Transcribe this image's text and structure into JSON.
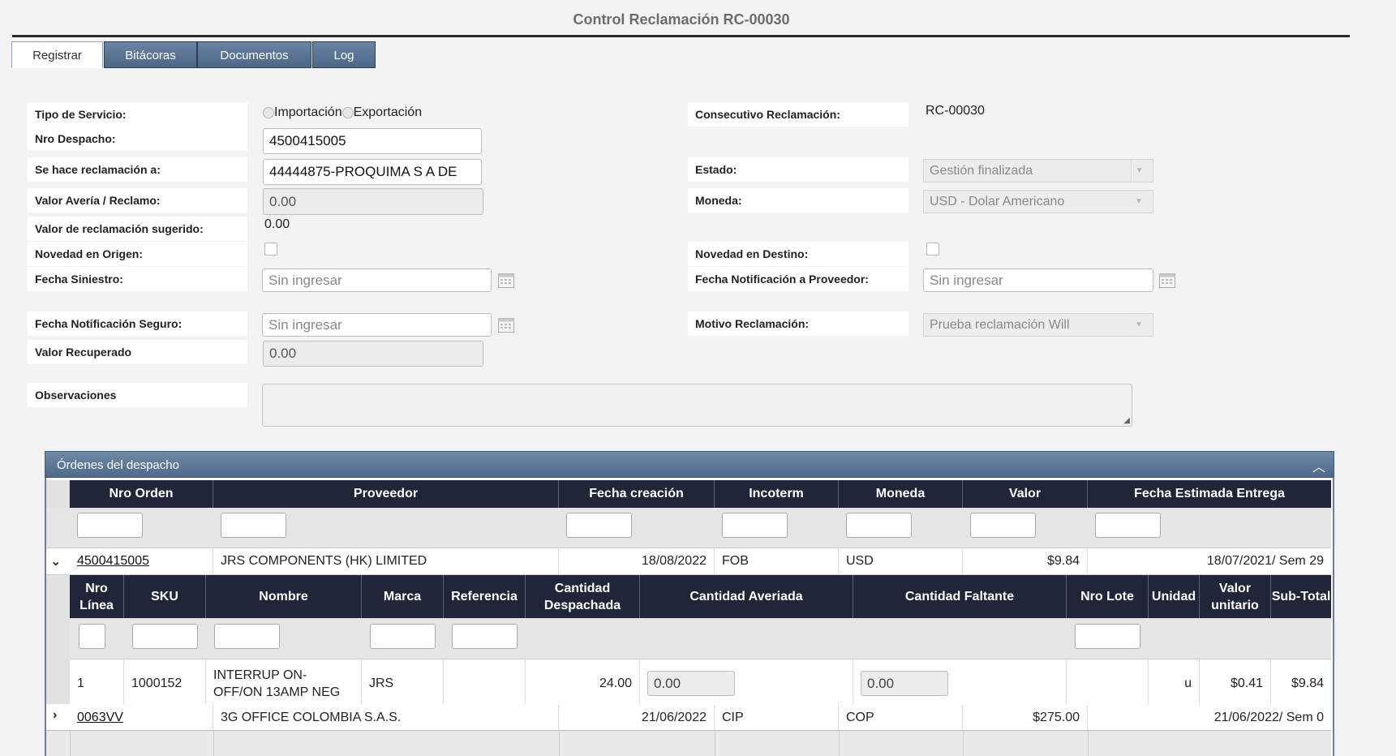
{
  "page_title": "Control Reclamación RC-00030",
  "tabs": [
    {
      "label": "Registrar"
    },
    {
      "label": "Bitácoras"
    },
    {
      "label": "Documentos"
    },
    {
      "label": "Log"
    }
  ],
  "form": {
    "tipo_servicio": {
      "label": "Tipo de Servicio:",
      "options": [
        "Importación",
        "Exportación"
      ]
    },
    "nro_despacho": {
      "label": "Nro Despacho:",
      "value": "4500415005"
    },
    "reclamacion_a": {
      "label": "Se hace reclamación a:",
      "value": "44444875-PROQUIMA S A DE"
    },
    "valor_averia": {
      "label": "Valor Avería / Reclamo:",
      "value": "0.00"
    },
    "valor_sugerido": {
      "label": "Valor de reclamación sugerido:",
      "value": "0.00"
    },
    "novedad_origen": {
      "label": "Novedad en Origen:"
    },
    "fecha_siniestro": {
      "label": "Fecha Siniestro:",
      "placeholder": "Sin ingresar"
    },
    "fecha_notif_seguro": {
      "label": "Fecha Notificación Seguro:",
      "placeholder": "Sin ingresar"
    },
    "valor_recuperado": {
      "label": "Valor Recuperado",
      "value": "0.00"
    },
    "observaciones": {
      "label": "Observaciones",
      "value": ""
    },
    "consecutivo": {
      "label": "Consecutivo Reclamación:",
      "value": "RC-00030"
    },
    "estado": {
      "label": "Estado:",
      "value": "Gestión finalizada"
    },
    "moneda": {
      "label": "Moneda:",
      "value": "USD - Dolar Americano"
    },
    "novedad_destino": {
      "label": "Novedad en Destino:"
    },
    "fecha_notif_proveedor": {
      "label": "Fecha Notificación a Proveedor:",
      "placeholder": "Sin ingresar"
    },
    "motivo": {
      "label": "Motivo Reclamación:",
      "value": "Prueba reclamación Will"
    }
  },
  "orders_panel": {
    "title": "Órdenes del despacho",
    "columns": [
      "Nro Orden",
      "Proveedor",
      "Fecha creación",
      "Incoterm",
      "Moneda",
      "Valor",
      "Fecha Estimada Entrega"
    ],
    "rows": [
      {
        "nro": "4500415005",
        "proveedor": "JRS COMPONENTS (HK) LIMITED",
        "fecha": "18/08/2022",
        "incoterm": "FOB",
        "moneda": "USD",
        "valor": "$9.84",
        "entrega": "18/07/2021/ Sem 29"
      },
      {
        "nro": "0063VV",
        "proveedor": "3G OFFICE COLOMBIA S.A.S.",
        "fecha": "21/06/2022",
        "incoterm": "CIP",
        "moneda": "COP",
        "valor": "$275.00",
        "entrega": "21/06/2022/ Sem 0"
      }
    ],
    "detail_columns": {
      "linea": "Nro Línea",
      "sku": "SKU",
      "nombre": "Nombre",
      "marca": "Marca",
      "referencia": "Referencia",
      "despachada": "Cantidad Despachada",
      "averiada": "Cantidad Averiada",
      "faltante": "Cantidad Faltante",
      "lote": "Nro Lote",
      "unidad": "Unidad",
      "unitario": "Valor unitario",
      "subtotal": "Sub-Total"
    },
    "detail_rows": [
      {
        "linea": "1",
        "sku": "1000152",
        "nombre": "INTERRUP ON-OFF/ON 13AMP NEG",
        "marca": "JRS",
        "referencia": "",
        "despachada": "24.00",
        "averiada": "0.00",
        "faltante": "0.00",
        "lote": "",
        "unidad": "u",
        "unitario": "$0.41",
        "subtotal": "$9.84"
      }
    ]
  }
}
